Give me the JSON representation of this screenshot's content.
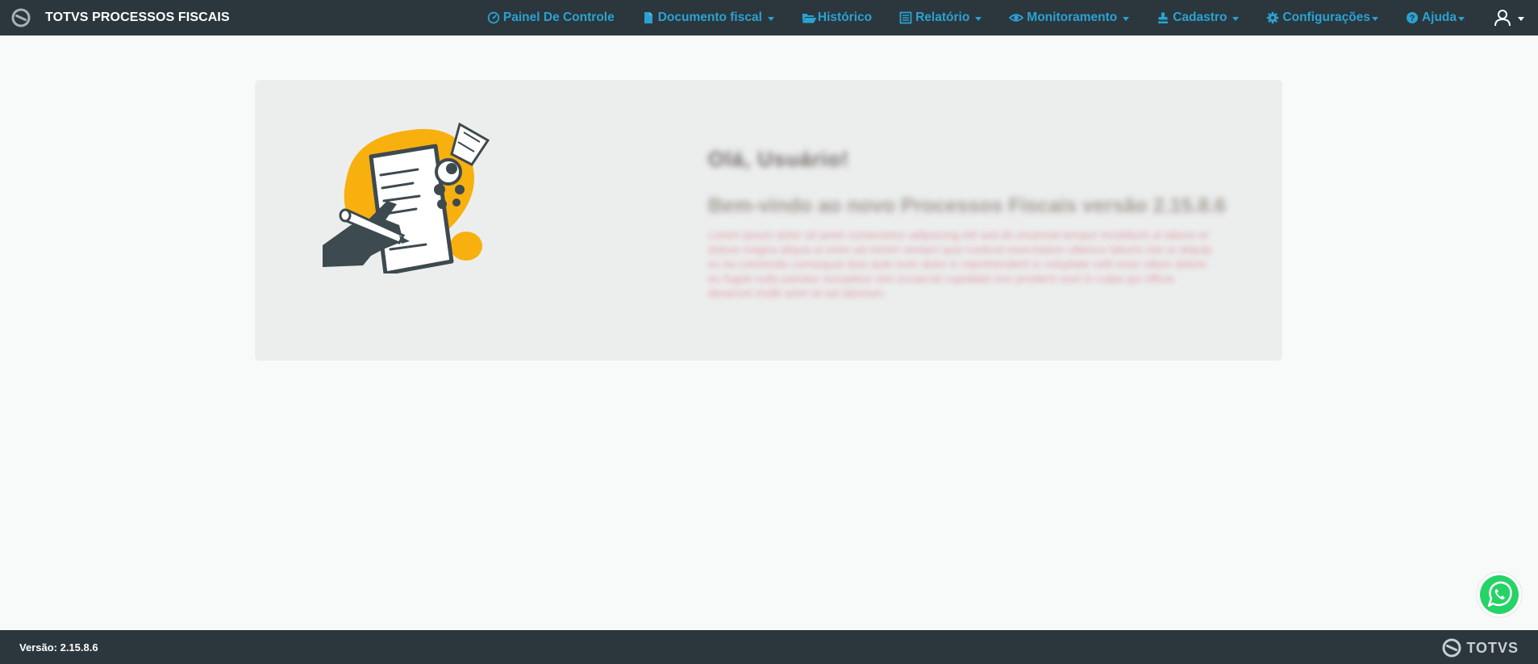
{
  "app": {
    "title": "TOTVS PROCESSOS FISCAIS",
    "logo_icon": "totvs-logo-icon"
  },
  "nav": {
    "items": [
      {
        "label": "Painel De Controle",
        "icon": "dashboard-icon",
        "has_dropdown": false
      },
      {
        "label": "Documento fiscal",
        "icon": "file-icon",
        "has_dropdown": true
      },
      {
        "label": "Histórico",
        "icon": "folder-open-icon",
        "has_dropdown": false
      },
      {
        "label": "Relatório",
        "icon": "list-icon",
        "has_dropdown": true
      },
      {
        "label": "Monitoramento",
        "icon": "eye-icon",
        "has_dropdown": true
      },
      {
        "label": "Cadastro",
        "icon": "stamp-icon",
        "has_dropdown": true
      },
      {
        "label": "Configurações",
        "icon": "gear-icon",
        "has_dropdown": true
      },
      {
        "label": "Ajuda",
        "icon": "help-circle-icon",
        "has_dropdown": true
      }
    ],
    "user_icon": "user-icon"
  },
  "card": {
    "illustration": "document-signing-illustration",
    "title_redacted": "Olá, Usuário!",
    "subtitle_redacted": "Bem-vindo ao novo Processos Fiscais versão 2.15.8.6",
    "body_redacted": "Lorem ipsum dolor sit amet consectetur adipiscing elit sed do eiusmod tempor incididunt ut labore et dolore magna aliqua ut enim ad minim veniam quis nostrud exercitation ullamco laboris nisi ut aliquip ex ea commodo consequat duis aute irure dolor in reprehenderit in voluptate velit esse cillum dolore eu fugiat nulla pariatur excepteur sint occaecat cupidatat non proident sunt in culpa qui officia deserunt mollit anim id est laborum."
  },
  "footer": {
    "version": "Versão: 2.15.8.6",
    "brand": "TOTVS"
  },
  "colors": {
    "navbar_bg": "#2b373d",
    "nav_link": "#2aa2d3",
    "page_bg": "#f8f9f9",
    "card_bg": "#eceeee",
    "accent_yellow": "#f8b00f",
    "whatsapp_green": "#25d366"
  },
  "whatsapp": {
    "icon": "whatsapp-icon"
  }
}
